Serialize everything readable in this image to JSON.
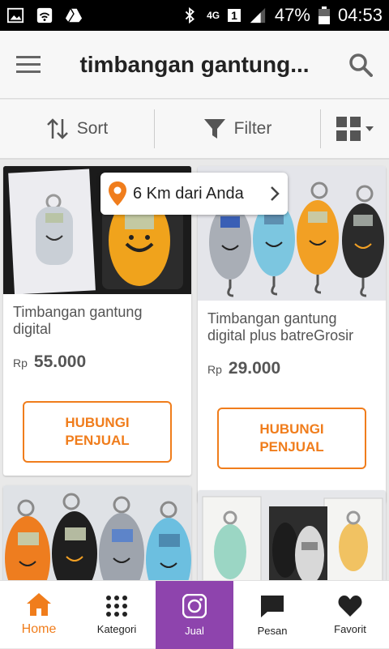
{
  "status": {
    "network": "4G",
    "sim": "1",
    "battery": "47%",
    "time": "04:53"
  },
  "header": {
    "title": "timbangan gantung..."
  },
  "filterbar": {
    "sort_label": "Sort",
    "filter_label": "Filter"
  },
  "location_badge": {
    "text": "6 Km dari Anda"
  },
  "products": [
    {
      "name": "Timbangan gantung digital",
      "currency": "Rp",
      "price": "55.000",
      "cta": "HUBUNGI\nPENJUAL"
    },
    {
      "name": "Timbangan gantung digital plus batreGrosir",
      "currency": "Rp",
      "price": "29.000",
      "cta": "HUBUNGI\nPENJUAL"
    }
  ],
  "bottom_nav": {
    "items": [
      {
        "label": "Home",
        "icon": "home-icon"
      },
      {
        "label": "Kategori",
        "icon": "grid-dots-icon"
      },
      {
        "label": "Jual",
        "icon": "camera-icon"
      },
      {
        "label": "Pesan",
        "icon": "chat-icon"
      },
      {
        "label": "Favorit",
        "icon": "heart-icon"
      }
    ]
  },
  "colors": {
    "accent": "#f07d1c",
    "sell": "#8e44ad"
  }
}
